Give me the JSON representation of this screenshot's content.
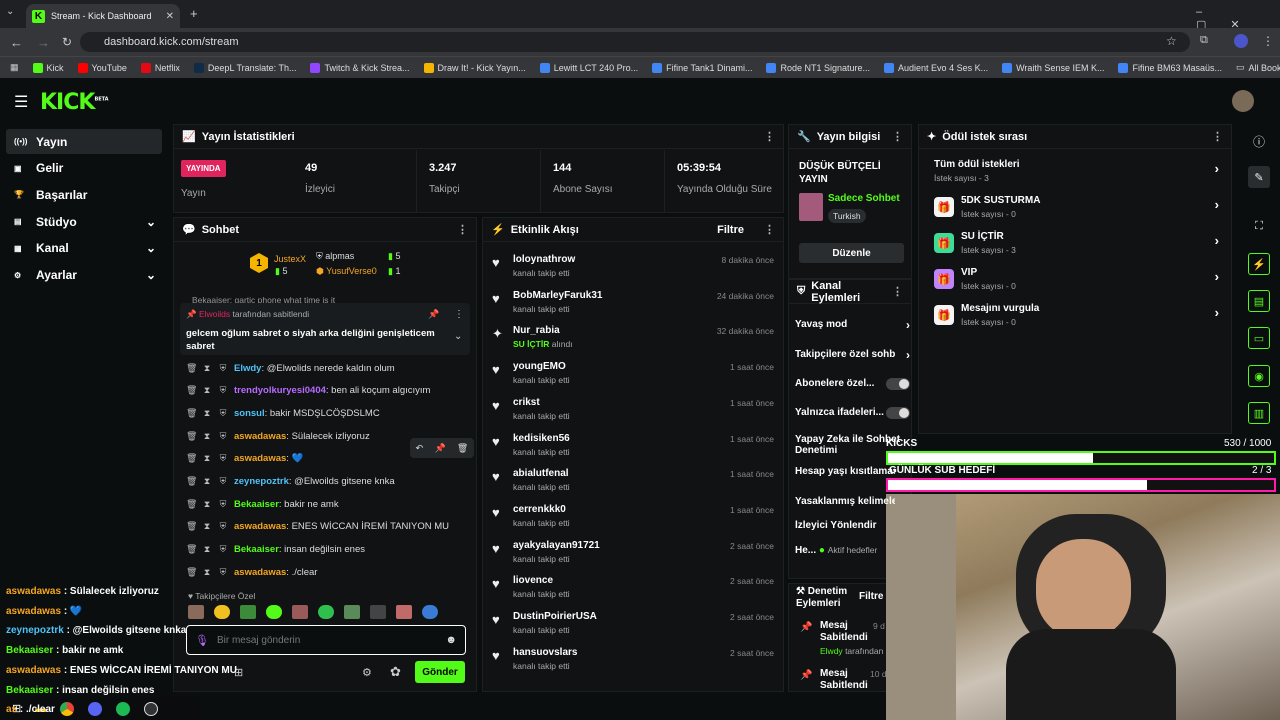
{
  "browser": {
    "tab_title": "Stream - Kick Dashboard",
    "url": "dashboard.kick.com/stream",
    "all_bookmarks": "All Bookmarks",
    "bookmarks": [
      {
        "label": "Kick",
        "color": "#53fc18"
      },
      {
        "label": "YouTube",
        "color": "#ff0000"
      },
      {
        "label": "Netflix",
        "color": "#e50914"
      },
      {
        "label": "DeepL Translate: Th...",
        "color": "#0f2b46"
      },
      {
        "label": "Twitch & Kick Strea...",
        "color": "#9146ff"
      },
      {
        "label": "Draw It! - Kick Yayın...",
        "color": "#f4b400"
      },
      {
        "label": "Lewitt LCT 240 Pro...",
        "color": "#4285f4"
      },
      {
        "label": "Fifine Tank1 Dinami...",
        "color": "#4285f4"
      },
      {
        "label": "Rode NT1 Signature...",
        "color": "#4285f4"
      },
      {
        "label": "Audient Evo 4 Ses K...",
        "color": "#4285f4"
      },
      {
        "label": "Wraith Sense IEM K...",
        "color": "#4285f4"
      },
      {
        "label": "Fifine BM63 Masaüs...",
        "color": "#4285f4"
      }
    ]
  },
  "brand": {
    "logo": "KICK",
    "badge": "BETA"
  },
  "sidebar": [
    {
      "label": "Yayın",
      "icon": "broadcast-icon",
      "chev": false
    },
    {
      "label": "Gelir",
      "icon": "wallet-icon",
      "chev": false
    },
    {
      "label": "Başarılar",
      "icon": "trophy-icon",
      "chev": false
    },
    {
      "label": "Stüdyo",
      "icon": "studio-icon",
      "chev": true
    },
    {
      "label": "Kanal",
      "icon": "channel-icon",
      "chev": true
    },
    {
      "label": "Ayarlar",
      "icon": "gear-icon",
      "chev": true
    }
  ],
  "stats": {
    "title": "Yayın İstatistikleri",
    "live_badge": "YAYINDA",
    "live_label": "Yayın",
    "items": [
      {
        "value": "49",
        "label": "İzleyici"
      },
      {
        "value": "3.247",
        "label": "Takipçi"
      },
      {
        "value": "144",
        "label": "Abone Sayısı"
      },
      {
        "value": "05:39:54",
        "label": "Yayında Olduğu Süre"
      }
    ]
  },
  "chat": {
    "title": "Sohbet",
    "leaders": [
      {
        "rank": "1",
        "name": "JustexX",
        "count": "5"
      },
      {
        "name": "alpmas",
        "count": "5"
      },
      {
        "name": "YusufVerse0",
        "count": "1"
      }
    ],
    "partial_top": "Bekaaiser: gartic phone what time is it",
    "pinned_by": "Elwoilds",
    "pinned_suffix": "tarafından sabitlendi",
    "pinned_text": "gelcem oğlum sabret o siyah arka deliğini genişleticem sabret",
    "messages": [
      {
        "user": "Elwdy",
        "color": "#4fc3f7",
        "text": ": @Elwolids nerede kaldın olum"
      },
      {
        "user": "trendyolkuryesi0404",
        "color": "#b86cff",
        "text": ": ben ali koçum algıcıyım"
      },
      {
        "user": "sonsul",
        "color": "#4fc3f7",
        "text": ": bakir MSDŞLCÖŞDSLMC"
      },
      {
        "user": "aswadawas",
        "color": "#f5a623",
        "text": ": Sülalecek izliyoruz"
      },
      {
        "user": "aswadawas",
        "color": "#f5a623",
        "text": ": 💙"
      },
      {
        "user": "zeynepoztrk",
        "color": "#4fc3f7",
        "text": ": @Elwoilds gitsene knka"
      },
      {
        "user": "Bekaaiser",
        "color": "#53fc18",
        "text": ": bakir ne amk"
      },
      {
        "user": "aswadawas",
        "color": "#f5a623",
        "text": ": ENES WİCCAN İREMİ TANIYON MU"
      },
      {
        "user": "Bekaaiser",
        "color": "#53fc18",
        "text": ": insan değilsin enes"
      },
      {
        "user": "aswadawas",
        "color": "#f5a623",
        "text": ": ./clear"
      }
    ],
    "followers_only": "Takipçilere Özel",
    "placeholder": "Bir mesaj gönderin",
    "send": "Gönder"
  },
  "activity": {
    "title": "Etkinlik Akışı",
    "filter": "Filtre",
    "items": [
      {
        "name": "loloynathrow",
        "sub": "kanalı takip etti",
        "time": "8 dakika önce"
      },
      {
        "name": "BobMarleyFaruk31",
        "sub": "kanalı takip etti",
        "time": "24 dakika önce"
      },
      {
        "name": "Nur_rabia",
        "sub_hl": "SU İÇTİR",
        "sub": "alındı",
        "time": "32 dakika önce"
      },
      {
        "name": "youngEMO",
        "sub": "kanalı takip etti",
        "time": "1 saat önce"
      },
      {
        "name": "crikst",
        "sub": "kanalı takip etti",
        "time": "1 saat önce"
      },
      {
        "name": "kedisiken56",
        "sub": "kanalı takip etti",
        "time": "1 saat önce"
      },
      {
        "name": "abialutfenal",
        "sub": "kanalı takip etti",
        "time": "1 saat önce"
      },
      {
        "name": "cerrenkkk0",
        "sub": "kanalı takip etti",
        "time": "1 saat önce"
      },
      {
        "name": "ayakyalayan91721",
        "sub": "kanalı takip etti",
        "time": "2 saat önce"
      },
      {
        "name": "liovence",
        "sub": "kanalı takip etti",
        "time": "2 saat önce"
      },
      {
        "name": "DustinPoirierUSA",
        "sub": "kanalı takip etti",
        "time": "2 saat önce"
      },
      {
        "name": "hansuovslars",
        "sub": "kanalı takip etti",
        "time": "2 saat önce"
      }
    ]
  },
  "info": {
    "title": "Yayın bilgisi",
    "stream_title": "DÜŞÜK BÜTÇELİ YAYIN",
    "category": "Sadece Sohbet",
    "tag": "Turkish",
    "edit": "Düzenle"
  },
  "actions": {
    "title": "Kanal Eylemleri",
    "items": [
      {
        "label": "Yavaş mod",
        "type": "chev"
      },
      {
        "label": "Takipçilere özel sohbet",
        "type": "chev"
      },
      {
        "label": "Abonelere özel...",
        "type": "toggle"
      },
      {
        "label": "Yalnızca ifadeleri...",
        "type": "toggle"
      },
      {
        "label": "Yapay Zeka ile Sohbet Denetimi",
        "type": "none"
      },
      {
        "label": "Hesap yaşı kısıtlaması",
        "type": "none"
      },
      {
        "label": "Yasaklanmış kelimeler",
        "type": "none"
      },
      {
        "label": "İzleyici Yönlendir",
        "type": "none"
      }
    ],
    "last_label": "He...",
    "last_status": "Aktif hedefler"
  },
  "moderation": {
    "title": "Denetim Eylemleri",
    "filter": "Filtre",
    "items": [
      {
        "label": "Mesaj Sabitlendi",
        "by": "Elwdy",
        "by_suffix": "tarafından",
        "time": "9 d"
      },
      {
        "label": "Mesaj Sabitlendi",
        "time": "10 d"
      }
    ]
  },
  "rewards": {
    "title": "Ödül istek sırası",
    "items": [
      {
        "name": "Tüm ödül istekleri",
        "count": "İstek sayısı - 3",
        "icon": "",
        "color": ""
      },
      {
        "name": "5DK SUSTURMA",
        "count": "İstek sayısı - 0",
        "icon": "gift-icon",
        "color": "#f4f4f4"
      },
      {
        "name": "SU İÇTİR",
        "count": "İstek sayısı - 3",
        "icon": "gift-icon",
        "color": "#3ddc97"
      },
      {
        "name": "VIP",
        "count": "İstek sayısı - 0",
        "icon": "gift-icon",
        "color": "#c084fc"
      },
      {
        "name": "Mesajını vurgula",
        "count": "İstek sayısı - 0",
        "icon": "gift-icon",
        "color": "#f4f4f4"
      }
    ]
  },
  "overlay": {
    "goal1_label": "KICKS",
    "goal1_value": "530 / 1000",
    "goal1_progress": 0.53,
    "goal2_label": "GÜNLÜK SUB HEDEFİ",
    "goal2_value": "2 / 3",
    "goal2_progress": 0.67,
    "chat": [
      {
        "user": "aswadawas",
        "color": "#f5a623",
        "text": " : Sülalecek izliyoruz"
      },
      {
        "user": "aswadawas",
        "color": "#f5a623",
        "text": " : 💙"
      },
      {
        "user": "zeynepoztrk",
        "color": "#4fc3f7",
        "text": " : @Elwoilds gitsene knka"
      },
      {
        "user": "Bekaaiser",
        "color": "#53fc18",
        "text": " : bakir ne amk"
      },
      {
        "user": "aswadawas",
        "color": "#f5a623",
        "text": " : ENES WİCCAN İREMİ TANIYON MU"
      },
      {
        "user": "Bekaaiser",
        "color": "#53fc18",
        "text": " : insan değilsin enes"
      },
      {
        "user": "as",
        "color": "#f5a623",
        "text": " : ./clear"
      }
    ]
  }
}
